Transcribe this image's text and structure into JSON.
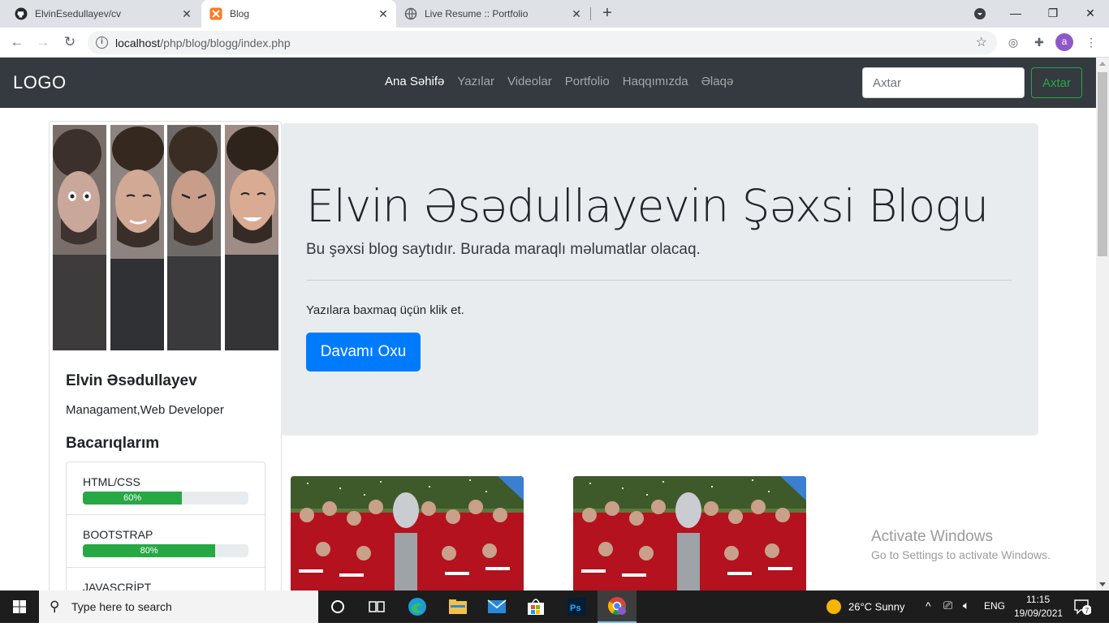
{
  "browser": {
    "tabs": [
      {
        "title": "ElvinEsedullayev/cv",
        "icon": "github-icon"
      },
      {
        "title": "Blog",
        "icon": "xampp-icon"
      },
      {
        "title": "Live Resume :: Portfolio",
        "icon": "globe-icon"
      }
    ],
    "url_host": "localhost",
    "url_path": "/php/blog/blogg/index.php",
    "profile_initial": "a"
  },
  "navbar": {
    "logo": "LOGO",
    "links": [
      "Ana Səhifə",
      "Yazılar",
      "Videolar",
      "Portfolio",
      "Haqqımızda",
      "Əlaqə"
    ],
    "search_placeholder": "Axtar",
    "search_button": "Axtar"
  },
  "profile": {
    "name": "Elvin Əsədullayev",
    "role": "Managament,Web Developer",
    "skills_title": "Bacarıqlarım",
    "skills": [
      {
        "name": "HTML/CSS",
        "label": "60%",
        "percent": 60
      },
      {
        "name": "BOOTSTRAP",
        "label": "80%",
        "percent": 80
      },
      {
        "name": "JAVASCRİPT",
        "label": "",
        "percent": 0
      }
    ]
  },
  "jumbotron": {
    "title": "Elvin Əsədullayevin Şəxsi Blogu",
    "lead": "Bu şəxsi blog saytıdır. Burada maraqlı məlumatlar olacaq.",
    "text": "Yazılara baxmaq üçün klik et.",
    "button": "Davamı Oxu"
  },
  "watermark": {
    "line1": "Activate Windows",
    "line2": "Go to Settings to activate Windows."
  },
  "taskbar": {
    "search_placeholder": "Type here to search",
    "weather": "26°C  Sunny",
    "language": "ENG",
    "time": "11:15",
    "date": "19/09/2021",
    "notifications": "7"
  },
  "colors": {
    "navbar_bg": "#343a40",
    "jumbotron_bg": "#e9ecef",
    "primary": "#007bff",
    "success": "#28a745"
  }
}
